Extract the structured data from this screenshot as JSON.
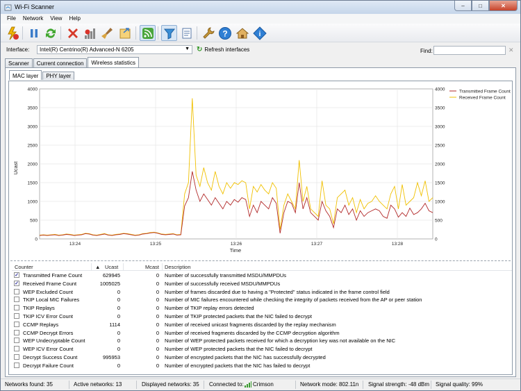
{
  "window": {
    "title": "Wi-Fi Scanner"
  },
  "menu": [
    "File",
    "Network",
    "View",
    "Help"
  ],
  "toolbar": {
    "icons": [
      "start-scan-icon",
      "pause-icon",
      "refresh-icon",
      "delete-icon",
      "signal-bars-icon",
      "clear-icon",
      "export-icon",
      "rss-feed-icon",
      "filter-icon",
      "notes-icon",
      "settings-wrench-icon",
      "help-icon",
      "home-icon",
      "info-icon"
    ]
  },
  "interface": {
    "label": "Interface:",
    "selected": "Intel(R) Centrino(R) Advanced-N 6205",
    "refresh_label": "Refresh interfaces",
    "find_label": "Find:",
    "find_value": ""
  },
  "tabs": [
    "Scanner",
    "Current connection",
    "Wireless statistics"
  ],
  "active_tab": "Wireless statistics",
  "subtabs": [
    "MAC layer",
    "PHY layer"
  ],
  "active_subtab": "MAC layer",
  "chart_data": {
    "type": "line",
    "xlabel": "Time",
    "ylabel": "Ucast",
    "ylim": [
      0,
      4000
    ],
    "yticks": [
      0,
      500,
      1000,
      1500,
      2000,
      2500,
      3000,
      3500,
      4000
    ],
    "xticks": [
      "13:24",
      "13:25",
      "13:26",
      "13:27",
      "13:28"
    ],
    "grid": true,
    "legend": "top-right",
    "colors": {
      "Transmitted Frame Count": "#b22a2a",
      "Received Frame Count": "#f0c000"
    },
    "series": [
      {
        "name": "Transmitted Frame Count",
        "values": [
          90,
          100,
          90,
          100,
          110,
          90,
          100,
          120,
          110,
          90,
          100,
          110,
          140,
          130,
          100,
          90,
          110,
          130,
          100,
          90,
          110,
          120,
          140,
          130,
          110,
          90,
          100,
          130,
          140,
          160,
          170,
          150,
          120,
          110,
          120,
          130,
          100,
          110,
          880,
          1100,
          1800,
          1300,
          1000,
          1200,
          1050,
          900,
          1100,
          950,
          800,
          1000,
          900,
          1050,
          980,
          1100,
          1050,
          600,
          900,
          700,
          1000,
          900,
          800,
          1100,
          950,
          150,
          700,
          1000,
          950,
          700,
          1500,
          800,
          1100,
          700,
          600,
          500,
          1000,
          750,
          600,
          300,
          800,
          700,
          900,
          650,
          800,
          500,
          750,
          600,
          700,
          750,
          800,
          750,
          600,
          550,
          900,
          800,
          580,
          700,
          600,
          820,
          650,
          700,
          800,
          950,
          750,
          700
        ]
      },
      {
        "name": "Received Frame Count",
        "values": [
          100,
          110,
          100,
          110,
          120,
          100,
          110,
          130,
          120,
          100,
          110,
          120,
          150,
          140,
          110,
          100,
          120,
          140,
          110,
          100,
          120,
          130,
          150,
          140,
          120,
          100,
          110,
          140,
          150,
          170,
          180,
          160,
          130,
          120,
          130,
          140,
          110,
          120,
          1200,
          1500,
          3750,
          1700,
          1400,
          1900,
          1500,
          1300,
          1800,
          1400,
          1200,
          1500,
          1350,
          1500,
          1450,
          1550,
          1500,
          800,
          1400,
          1250,
          1450,
          1300,
          1200,
          1500,
          1350,
          250,
          900,
          1200,
          1000,
          800,
          2100,
          1000,
          1400,
          800,
          700,
          600,
          1550,
          900,
          800,
          400,
          1100,
          1200,
          1300,
          900,
          1100,
          700,
          1050,
          800,
          950,
          1000,
          1150,
          1000,
          900,
          800,
          1200,
          1400,
          800,
          1450,
          900,
          1000,
          1100,
          1500,
          1150,
          1550,
          1000,
          1100
        ]
      }
    ]
  },
  "list": {
    "columns": [
      "Counter",
      "Ucast",
      "Mcast",
      "Description"
    ],
    "rows": [
      {
        "checked": true,
        "counter": "Transmitted Frame Count",
        "ucast": "629945",
        "mcast": "0",
        "desc": "Number of successfully transmitted MSDU/MMPDUs"
      },
      {
        "checked": true,
        "counter": "Received Frame Count",
        "ucast": "1005025",
        "mcast": "0",
        "desc": "Number of successfully received MSDU/MMPDUs"
      },
      {
        "checked": false,
        "counter": "WEP Excluded Count",
        "ucast": "0",
        "mcast": "0",
        "desc": "Number of frames discarded due to having a \"Protected\" status indicated in the frame control field"
      },
      {
        "checked": false,
        "counter": "TKIP Local MIC Failures",
        "ucast": "0",
        "mcast": "0",
        "desc": "Number of MIC failures encountered while checking the integrity of packets received from the AP or peer station"
      },
      {
        "checked": false,
        "counter": "TKIP Replays",
        "ucast": "0",
        "mcast": "0",
        "desc": "Number of TKIP replay errors detected"
      },
      {
        "checked": false,
        "counter": "TKIP ICV Error Count",
        "ucast": "0",
        "mcast": "0",
        "desc": "Number of TKIP protected packets that the NIC failed to decrypt"
      },
      {
        "checked": false,
        "counter": "CCMP Replays",
        "ucast": "1114",
        "mcast": "0",
        "desc": "Number of received unicast fragments discarded by the replay mechanism"
      },
      {
        "checked": false,
        "counter": "CCMP Decrypt Errors",
        "ucast": "0",
        "mcast": "0",
        "desc": "Number of received fragments discarded by the CCMP decryption algorithm"
      },
      {
        "checked": false,
        "counter": "WEP Undecryptable Count",
        "ucast": "0",
        "mcast": "0",
        "desc": "Number of WEP protected packets received for which a decryption key was not available on the NIC"
      },
      {
        "checked": false,
        "counter": "WEP ICV Error Count",
        "ucast": "0",
        "mcast": "0",
        "desc": "Number of WEP protected packets that the NIC failed to decrypt"
      },
      {
        "checked": false,
        "counter": "Decrypt Success Count",
        "ucast": "995953",
        "mcast": "0",
        "desc": "Number of encrypted packets that the NIC has successfully decrypted"
      },
      {
        "checked": false,
        "counter": "Decrypt Failure Count",
        "ucast": "0",
        "mcast": "0",
        "desc": "Number of encrypted packets that the NIC has failed to decrypt"
      }
    ]
  },
  "status": {
    "networks_found": "Networks found: 35",
    "active_networks": "Active networks: 13",
    "displayed_networks": "Displayed networks: 35",
    "connected_to_label": "Connected to:",
    "connected_to": "Crimson",
    "network_mode": "Network mode: 802.11n",
    "signal_strength": "Signal strength: -48 dBm",
    "signal_quality": "Signal quality: 99%"
  }
}
